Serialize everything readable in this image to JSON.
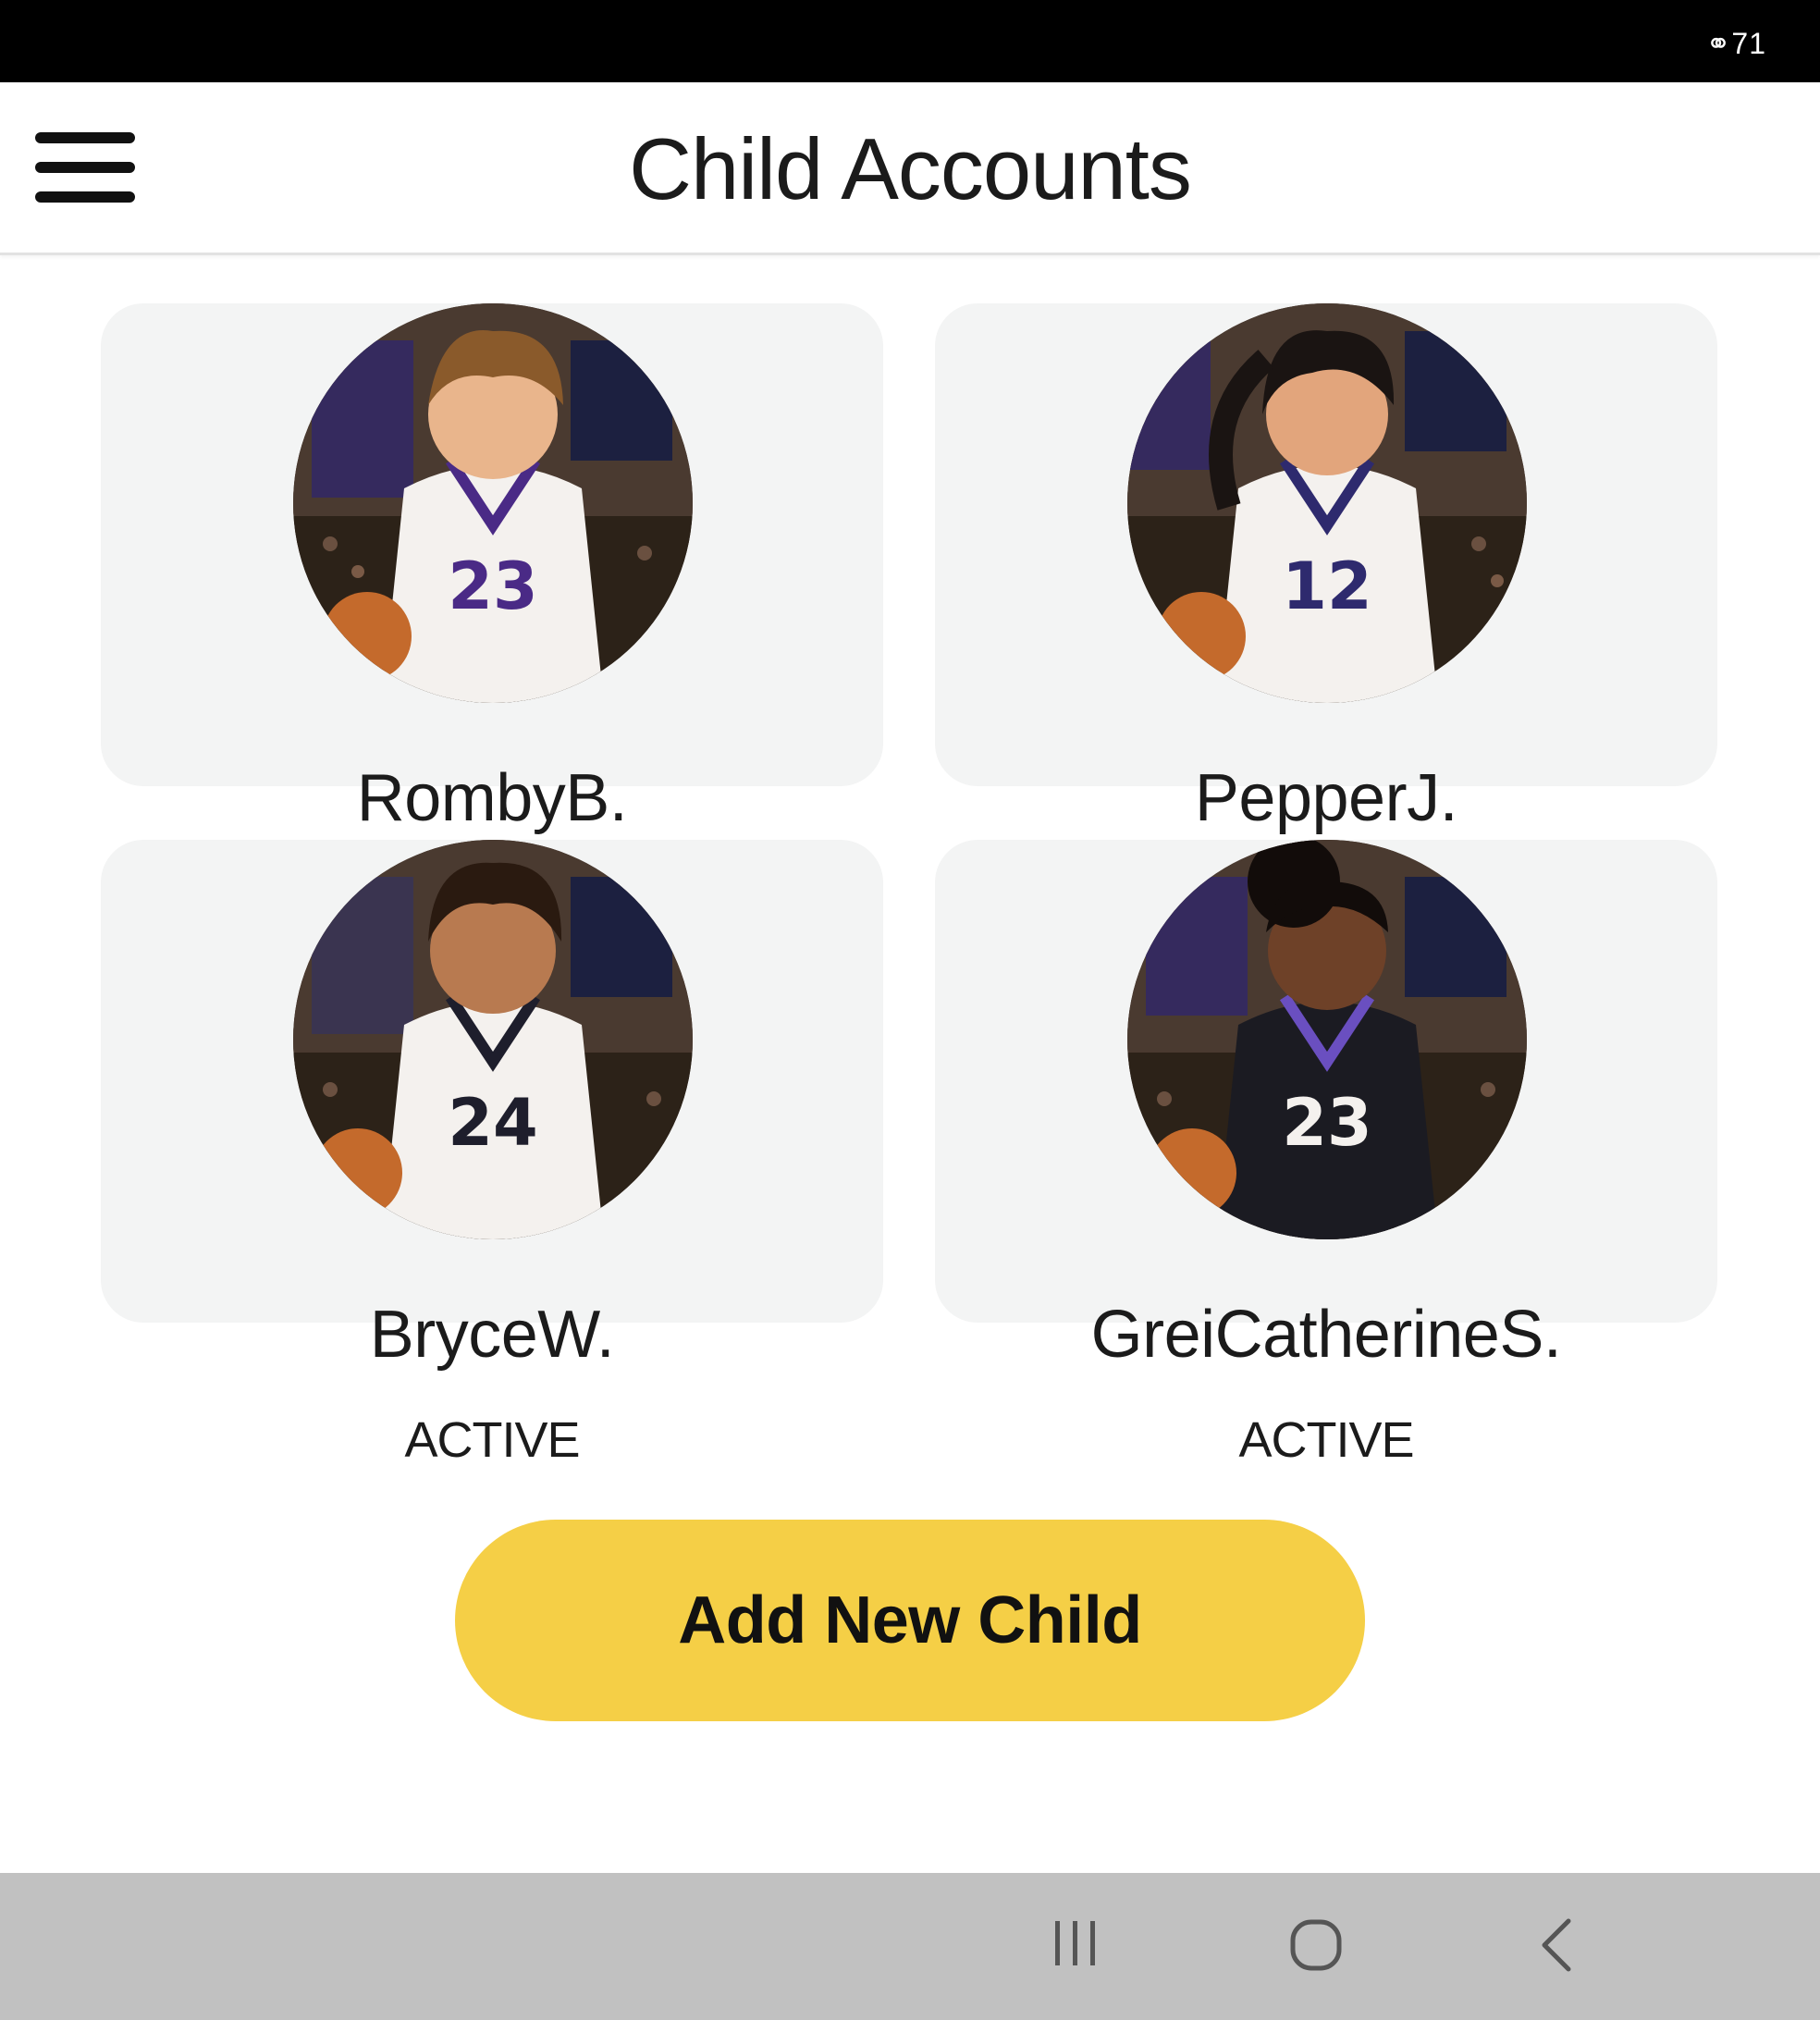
{
  "status_bar": {
    "battery": "71"
  },
  "header": {
    "title": "Child Accounts",
    "menu_icon": "hamburger-menu-icon"
  },
  "children": [
    {
      "name": "RombyB.",
      "status": "",
      "jersey": "23",
      "jersey_color": "#f4f1ee",
      "trim": "#4a2a86",
      "skin": "#e9b58c",
      "hair": "#8a5a2b"
    },
    {
      "name": "PepperJ.",
      "status": "",
      "jersey": "12",
      "jersey_color": "#f4f1ee",
      "trim": "#2e2a6e",
      "skin": "#e2a57c",
      "hair": "#1a1412"
    },
    {
      "name": "BryceW.",
      "status": "ACTIVE",
      "jersey": "24",
      "jersey_color": "#f4f1ee",
      "trim": "#1e1e2c",
      "skin": "#b87a50",
      "hair": "#2a1a10"
    },
    {
      "name": "GreiCatherineS.",
      "status": "ACTIVE",
      "jersey": "23",
      "jersey_color": "#1b1b22",
      "trim": "#6a4fc0",
      "skin": "#6e4128",
      "hair": "#120c0a"
    }
  ],
  "actions": {
    "add_child_label": "Add New Child"
  },
  "nav_bar": {
    "recents_icon": "recents-icon",
    "home_icon": "home-icon",
    "back_icon": "back-icon"
  },
  "colors": {
    "accent": "#f5cf46",
    "card_bg": "#f3f4f4",
    "nav_bg": "#c1c1c1"
  }
}
